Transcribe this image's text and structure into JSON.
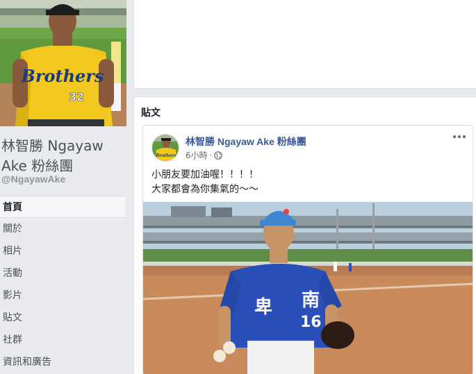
{
  "page": {
    "name": "林智勝 Ngayaw Ake 粉絲團",
    "handle": "@NgayawAke"
  },
  "nav": {
    "items": [
      {
        "label": "首頁",
        "active": true
      },
      {
        "label": "關於"
      },
      {
        "label": "相片"
      },
      {
        "label": "活動"
      },
      {
        "label": "影片"
      },
      {
        "label": "貼文"
      },
      {
        "label": "社群"
      },
      {
        "label": "資訊和廣告"
      }
    ]
  },
  "posts_section": {
    "title": "貼文"
  },
  "post": {
    "author": "林智勝 Ngayaw Ake 粉絲團",
    "time": "6小時",
    "separator": "·",
    "text_line1": "小朋友要加油喔！！！！",
    "text_line2": "大家都會為你集氣的～～",
    "icons": {
      "privacy": "globe-icon",
      "menu": "more-options-icon"
    }
  },
  "photo": {
    "jersey_text": "Brothers",
    "jersey_number": "32",
    "kid_jersey_number": "16"
  },
  "colors": {
    "link": "#385898",
    "background": "#e9ebee",
    "jersey_yellow": "#f2c81e",
    "kid_jersey_blue": "#2a4fb8"
  }
}
